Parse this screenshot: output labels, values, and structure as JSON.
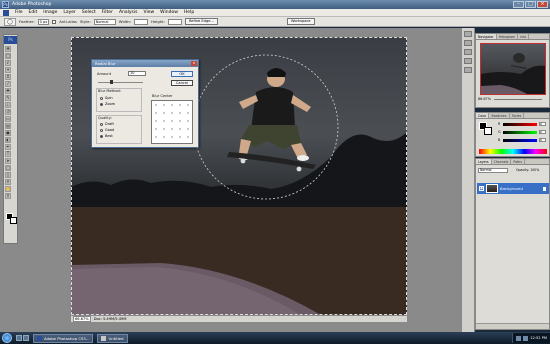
{
  "window": {
    "title": "Adobe Photoshop"
  },
  "menu": [
    "File",
    "Edit",
    "Image",
    "Layer",
    "Select",
    "Filter",
    "Analysis",
    "View",
    "Window",
    "Help"
  ],
  "options_bar": {
    "feather_label": "Feather:",
    "feather_value": "0 px",
    "antialias_label": "Anti-alias",
    "style_label": "Style:",
    "style_value": "Normal",
    "width_label": "Width:",
    "height_label": "Height:",
    "refine_edge": "Refine Edge...",
    "workspace": "Workspace"
  },
  "dialog": {
    "title": "Radial Blur",
    "amount_label": "Amount",
    "amount_value": "10",
    "ok": "OK",
    "cancel": "Cancel",
    "blur_method_label": "Blur Method:",
    "spin": "Spin",
    "zoom": "Zoom",
    "blur_center_label": "Blur Center",
    "quality_label": "Quality:",
    "draft": "Draft",
    "good": "Good",
    "best": "Best"
  },
  "document": {
    "zoom": "66.67%",
    "info": "Doc: 5.49M/5.49M"
  },
  "panels": {
    "navigator_tabs": [
      "Navigator",
      "Histogram",
      "Info"
    ],
    "navigator_zoom": "66.67%",
    "color_tabs": [
      "Color",
      "Swatches",
      "Styles"
    ],
    "color_channels": [
      {
        "label": "R",
        "value": "0"
      },
      {
        "label": "G",
        "value": "0"
      },
      {
        "label": "B",
        "value": "0"
      }
    ],
    "layers_tabs": [
      "Layers",
      "Channels",
      "Paths"
    ],
    "blend_mode": "Normal",
    "opacity": "Opacity: 100%",
    "layer_name": "Background"
  },
  "taskbar": {
    "items": [
      "Adobe Photoshop CS3...",
      "Untitled"
    ],
    "time": "12:52 PM"
  }
}
